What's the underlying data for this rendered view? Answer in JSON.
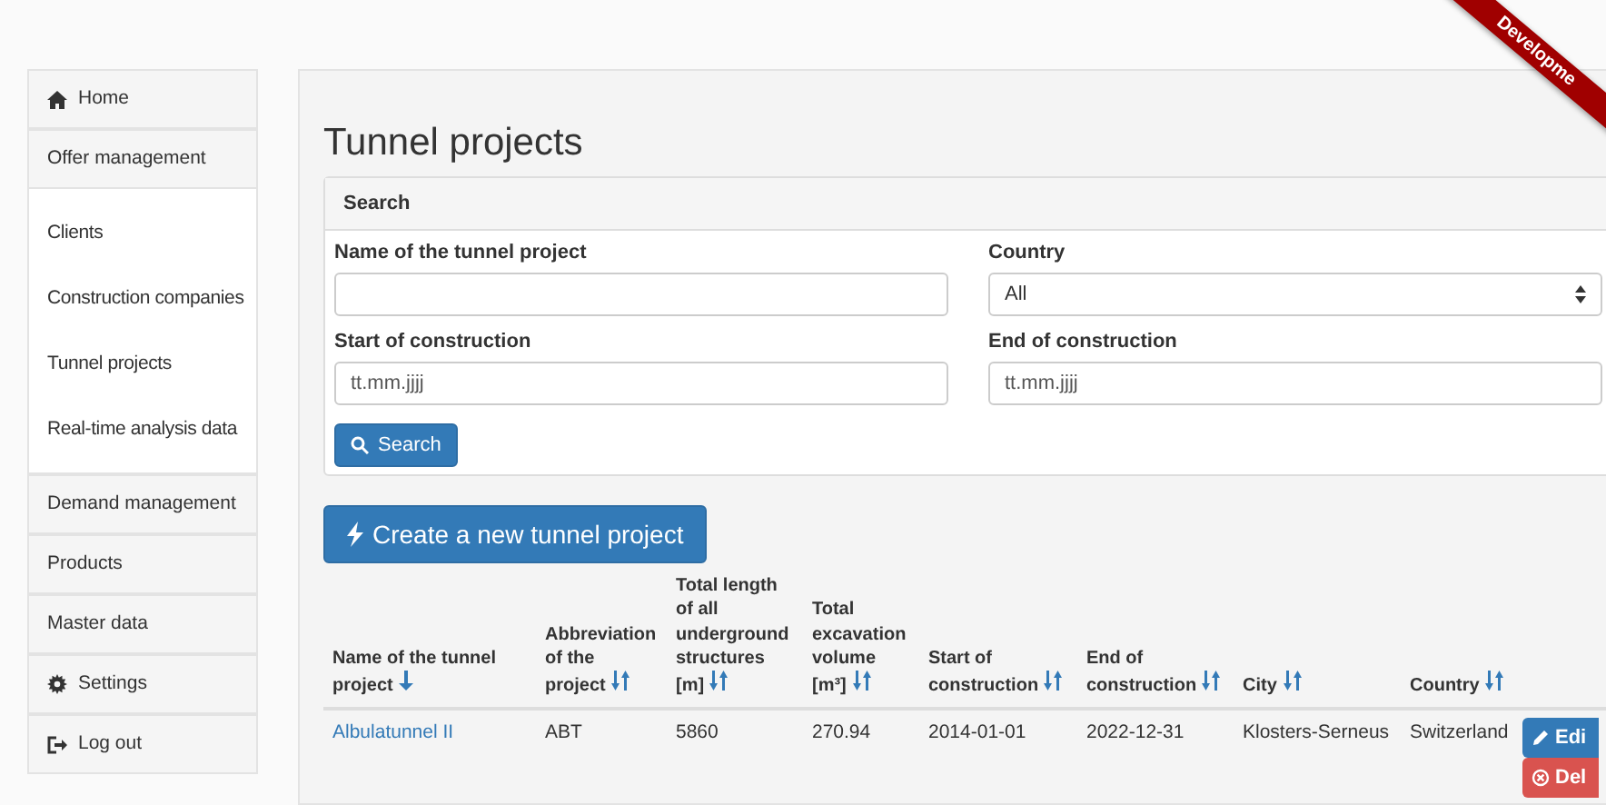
{
  "ribbon": "Developme",
  "sidebar": {
    "items": [
      {
        "label": "Home",
        "kind": "home",
        "selected": false
      },
      {
        "label": "Offer management",
        "kind": "plain",
        "selected": false,
        "expanded": true,
        "children": [
          {
            "label": "Clients",
            "selected": false
          },
          {
            "label": "Construction companies",
            "selected": false
          },
          {
            "label": "Tunnel projects",
            "selected": false
          },
          {
            "label": "Real-time analysis data",
            "selected": false
          }
        ]
      },
      {
        "label": "Demand management",
        "kind": "plain",
        "selected": false
      },
      {
        "label": "Products",
        "kind": "plain",
        "selected": false
      },
      {
        "label": "Master data",
        "kind": "plain",
        "selected": false
      },
      {
        "label": "Settings",
        "kind": "settings",
        "selected": false
      },
      {
        "label": "Log out",
        "kind": "logout",
        "selected": false
      }
    ]
  },
  "title": "Tunnel projects",
  "search": {
    "heading": "Search",
    "fields": [
      {
        "label": "Name of the tunnel project",
        "kind": "text"
      },
      {
        "label": "Country",
        "kind": "select",
        "value": "All"
      },
      {
        "label": "Start of construction",
        "kind": "text",
        "placeholder": "tt.mm.jjjj"
      },
      {
        "label": "End of construction",
        "kind": "text",
        "placeholder": "tt.mm.jjjj"
      }
    ],
    "button": "Search"
  },
  "create_button": "Create a new tunnel project",
  "table": {
    "columns": [
      {
        "label": "Name of the tunnel project",
        "sorted": true
      },
      {
        "label": "Abbreviation of the project",
        "sorted": false
      },
      {
        "label": "Total length of all underground structures [m]",
        "sorted": false
      },
      {
        "label": "Total excavation volume [m³]",
        "sorted": false
      },
      {
        "label": "Start of construction",
        "sorted": false
      },
      {
        "label": "End of construction",
        "sorted": false
      },
      {
        "label": "City",
        "sorted": false
      },
      {
        "label": "Country",
        "sorted": false
      }
    ],
    "rows": [
      {
        "cells": [
          "Albulatunnel II",
          "ABT",
          "5860",
          "270.94",
          "2014-01-01",
          "2022-12-31",
          "Klosters-Serneus",
          "Switzerland"
        ],
        "actions": [
          {
            "kind": "edit",
            "label": "Edi"
          },
          {
            "kind": "delete",
            "label": "Del"
          }
        ]
      }
    ]
  }
}
